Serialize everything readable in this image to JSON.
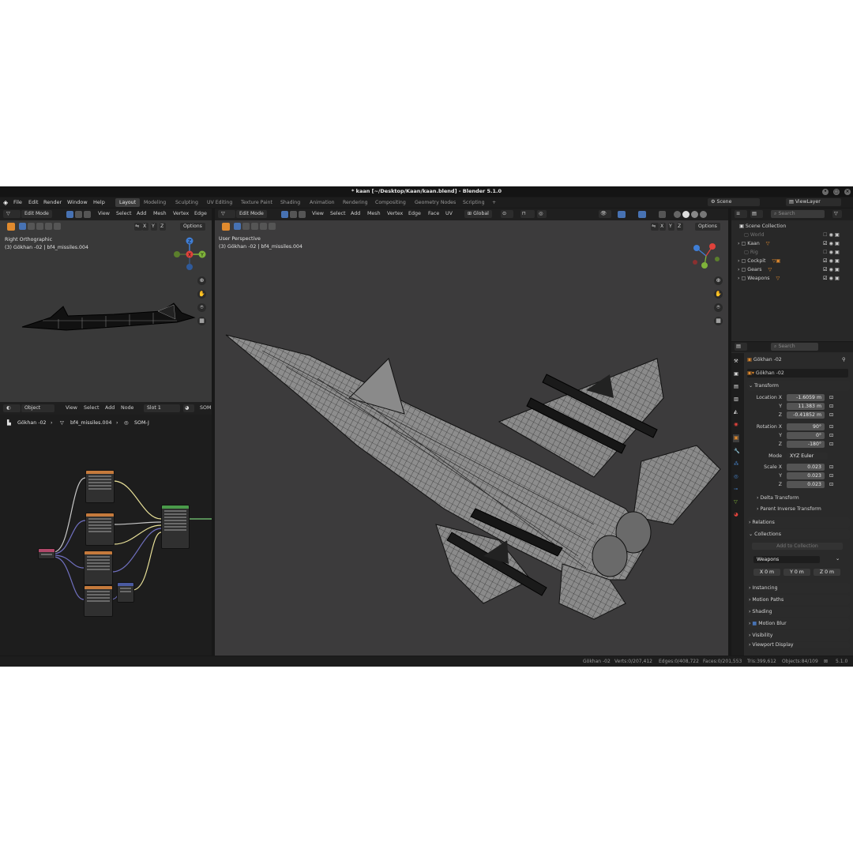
{
  "window": {
    "title": "* kaan [~/Desktop/Kaan/kaan.blend] - Blender 5.1.0",
    "controls": [
      "•",
      "▢",
      "×"
    ]
  },
  "menu": [
    "File",
    "Edit",
    "Render",
    "Window",
    "Help"
  ],
  "workspaces": [
    "Layout",
    "Modeling",
    "Sculpting",
    "UV Editing",
    "Texture Paint",
    "Shading",
    "Animation",
    "Rendering",
    "Compositing",
    "Geometry Nodes",
    "Scripting",
    "+"
  ],
  "scene": {
    "name": "Scene",
    "view_layer": "ViewLayer"
  },
  "viewport_small": {
    "mode": "Edit Mode",
    "menus": [
      "View",
      "Select",
      "Add",
      "Mesh",
      "Vertex",
      "Edge"
    ],
    "axes": [
      "X",
      "Y",
      "Z"
    ],
    "options": "Options",
    "view_name": "Right Orthographic",
    "object_info": "(3) Gökhan -02 | bf4_missiles.004",
    "gizmo": [
      "Z",
      "X",
      "Y"
    ]
  },
  "viewport_main": {
    "mode": "Edit Mode",
    "menus": [
      "View",
      "Select",
      "Add",
      "Mesh",
      "Vertex",
      "Edge",
      "Face",
      "UV"
    ],
    "transform_orientation": "Global",
    "axes": [
      "X",
      "Y",
      "Z"
    ],
    "options": "Options",
    "view_name": "User Perspective",
    "object_info": "(3) Gökhan -02 | bf4_missiles.004"
  },
  "node_editor": {
    "type": "Object",
    "menus": [
      "View",
      "Select",
      "Add",
      "Node"
    ],
    "slot": "Slot 1",
    "material_short": "SOM",
    "breadcrumb": [
      "Gökhan -02",
      "bf4_missiles.004",
      "SOM-J"
    ]
  },
  "outliner": {
    "search_placeholder": "Search",
    "root": "Scene Collection",
    "items": [
      {
        "name": "World",
        "enabled": false
      },
      {
        "name": "Kaan",
        "enabled": true
      },
      {
        "name": "Rig",
        "enabled": false
      },
      {
        "name": "Cockpit",
        "enabled": true
      },
      {
        "name": "Gears",
        "enabled": true
      },
      {
        "name": "Weapons",
        "enabled": true
      }
    ]
  },
  "properties": {
    "search_placeholder": "Search",
    "object_name": "Gökhan -02",
    "data_name": "Gökhan -02",
    "transform_label": "Transform",
    "location_label": "Location X",
    "location": {
      "x": "-1.6059 m",
      "y": "11.383 m",
      "z": "-0.41852 m"
    },
    "rotation_label": "Rotation X",
    "rotation": {
      "x": "90°",
      "y": "0°",
      "z": "-180°"
    },
    "mode_label": "Mode",
    "mode_value": "XYZ Euler",
    "scale_label": "Scale X",
    "scale": {
      "x": "0.023",
      "y": "0.023",
      "z": "0.023"
    },
    "y_label": "Y",
    "z_label": "Z",
    "delta_transform": "Delta Transform",
    "parent_inverse": "Parent Inverse Transform",
    "relations": "Relations",
    "collections": "Collections",
    "add_to_collection": "Add to Collection",
    "collection_name": "Weapons",
    "offset": {
      "x": "X   0 m",
      "y": "Y   0 m",
      "z": "Z   0 m"
    },
    "instancing": "Instancing",
    "motion_paths": "Motion Paths",
    "shading": "Shading",
    "motion_blur": "Motion Blur",
    "visibility": "Visibility",
    "viewport_display": "Viewport Display"
  },
  "statusbar": {
    "object": "Gökhan -02",
    "verts": "Verts:0/207,412",
    "edges": "Edges:0/408,722",
    "faces": "Faces:0/201,553",
    "tris": "Tris:399,612",
    "objects": "Objects:84/109",
    "version": "5.1.0"
  },
  "colors": {
    "accent": "#4772b3",
    "active_orange": "#e08a2e",
    "axis_x": "#e0423b",
    "axis_y": "#7fb33a",
    "axis_z": "#3f7ed6",
    "viewport_bg": "#393939",
    "node_bg": "#1d1d1d"
  }
}
